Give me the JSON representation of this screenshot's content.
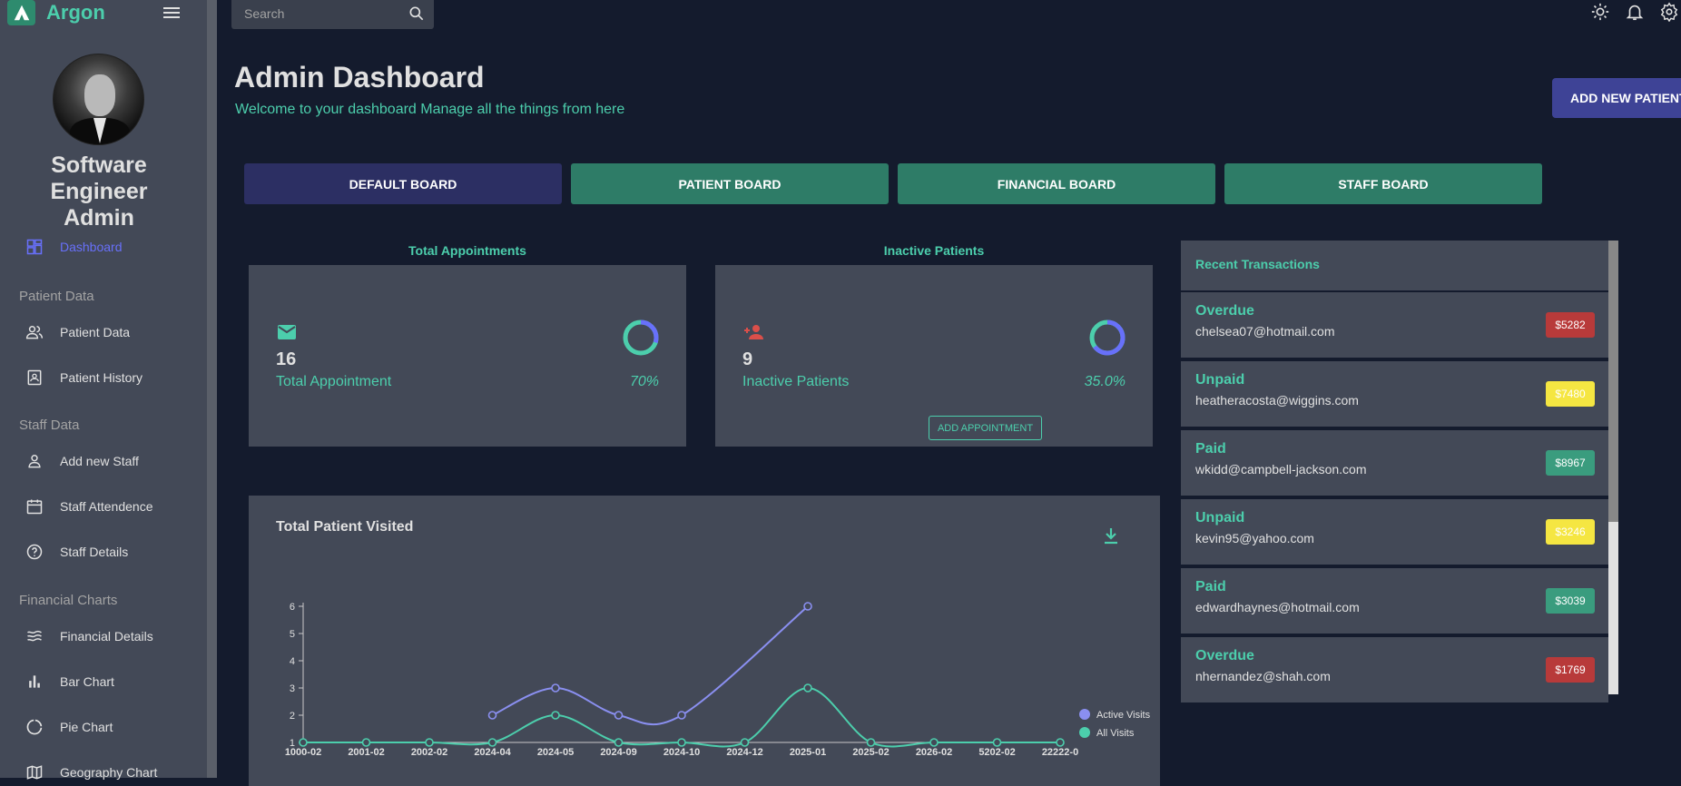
{
  "brand": {
    "name": "Argon"
  },
  "profile": {
    "name_line1": "Software Engineer",
    "name_line2": "Admin"
  },
  "sidebar": {
    "items": [
      {
        "label": "Dashboard",
        "icon": "dashboard-icon",
        "active": true
      },
      {
        "section": "Patient Data"
      },
      {
        "label": "Patient Data",
        "icon": "people-icon"
      },
      {
        "label": "Patient History",
        "icon": "contact-card-icon"
      },
      {
        "section": "Staff Data"
      },
      {
        "label": "Add new Staff",
        "icon": "person-icon"
      },
      {
        "label": "Staff Attendence",
        "icon": "calendar-icon"
      },
      {
        "label": "Staff Details",
        "icon": "help-circle-icon"
      },
      {
        "section": "Financial Charts"
      },
      {
        "label": "Financial Details",
        "icon": "waves-icon"
      },
      {
        "label": "Bar Chart",
        "icon": "bar-chart-icon"
      },
      {
        "label": "Pie Chart",
        "icon": "pie-chart-icon"
      },
      {
        "label": "Geography Chart",
        "icon": "map-icon"
      }
    ]
  },
  "search": {
    "placeholder": "Search"
  },
  "header": {
    "title": "Admin Dashboard",
    "subtitle": "Welcome to your dashboard Manage all the things from here",
    "add_button": "ADD NEW PATIENT"
  },
  "boards": [
    "DEFAULT BOARD",
    "PATIENT BOARD",
    "FINANCIAL BOARD",
    "STAFF BOARD"
  ],
  "stats": [
    {
      "label": "Total Appointments",
      "value": "16",
      "text": "Total Appointment",
      "percent": "70%",
      "progress": 0.7,
      "icon": "mail-icon"
    },
    {
      "label": "Inactive Patients",
      "value": "9",
      "text": "Inactive Patients",
      "percent": "35.0%",
      "progress": 0.35,
      "icon": "person-add-icon",
      "action": "ADD APPOINTMENT"
    }
  ],
  "transactions": {
    "title": "Recent Transactions",
    "items": [
      {
        "status": "Overdue",
        "email": "chelsea07@hotmail.com",
        "amount": "$5282",
        "color": "#b83a3a"
      },
      {
        "status": "Unpaid",
        "email": "heatheracosta@wiggins.com",
        "amount": "$7480",
        "color": "#f5e642"
      },
      {
        "status": "Paid",
        "email": "wkidd@campbell-jackson.com",
        "amount": "$8967",
        "color": "#3a9c7e"
      },
      {
        "status": "Unpaid",
        "email": "kevin95@yahoo.com",
        "amount": "$3246",
        "color": "#f5e642"
      },
      {
        "status": "Paid",
        "email": "edwardhaynes@hotmail.com",
        "amount": "$3039",
        "color": "#3a9c7e"
      },
      {
        "status": "Overdue",
        "email": "nhernandez@shah.com",
        "amount": "$1769",
        "color": "#b83a3a"
      }
    ]
  },
  "chart_data": {
    "type": "line",
    "title": "Total Patient Visited",
    "categories": [
      "1000-02",
      "2001-02",
      "2002-02",
      "2024-04",
      "2024-05",
      "2024-09",
      "2024-10",
      "2024-12",
      "2025-01",
      "2025-02",
      "2026-02",
      "5202-02",
      "22222-0"
    ],
    "series": [
      {
        "name": "Active Visits",
        "color": "#8a8ff0",
        "values": [
          null,
          null,
          null,
          2,
          3,
          2,
          2,
          null,
          6,
          null,
          null,
          null,
          null
        ]
      },
      {
        "name": "All Visits",
        "color": "#4cceac",
        "values": [
          1,
          1,
          1,
          1,
          2,
          1,
          1,
          1,
          3,
          1,
          1,
          1,
          1
        ]
      }
    ],
    "yticks": [
      1,
      2,
      3,
      4,
      5,
      6
    ],
    "ylim": [
      1,
      6
    ],
    "legend": "bottom-right"
  }
}
